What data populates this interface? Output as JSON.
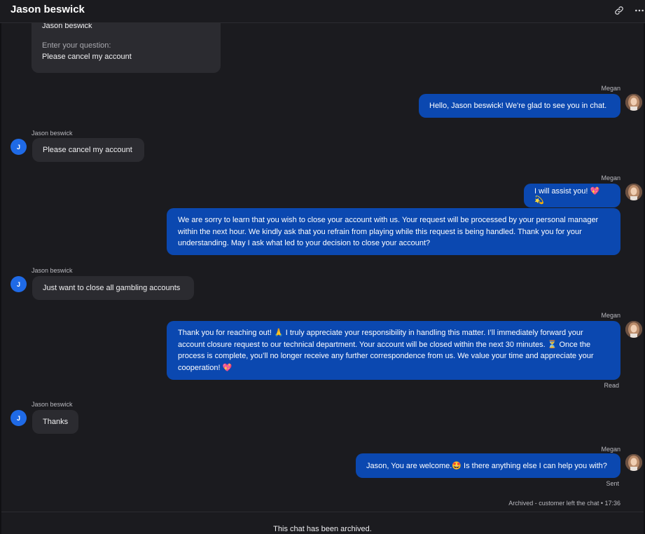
{
  "header": {
    "title": "Jason beswick",
    "link_icon": "link-icon",
    "more_icon": "more-horizontal-icon"
  },
  "form_card": {
    "name_value": "Jason beswick",
    "question_label": "Enter your question:",
    "question_value": "Please cancel my account"
  },
  "agent": {
    "name": "Megan"
  },
  "customer": {
    "name": "Jason beswick",
    "initial": "J"
  },
  "messages": [
    {
      "from": "agent",
      "text": "Hello, Jason beswick! We're glad to see you in chat."
    },
    {
      "from": "customer",
      "text": "Please cancel my account"
    },
    {
      "from": "agent",
      "text": "I will assist you! 💖 💫"
    },
    {
      "from": "agent",
      "text": "We are sorry to learn that you wish to close your account with us. Your request will be processed by your personal manager within the next hour. We kindly ask that you refrain from playing while this request is being handled. Thank you for your understanding. May I ask what led to your decision to close your account?"
    },
    {
      "from": "customer",
      "text": "Just want to close all gambling accounts"
    },
    {
      "from": "agent",
      "text": "Thank you for reaching out! 🙏 I truly appreciate your responsibility in handling this matter. I’ll immediately forward your account closure request to our technical department. Your account will be closed within the next 30 minutes. ⏳ Once the process is complete, you’ll no longer receive any further correspondence from us. We value your time and appreciate your cooperation! 💖"
    },
    {
      "from": "customer",
      "text": "Thanks"
    },
    {
      "from": "agent",
      "text": "Jason, You are welcome.🤩 Is there anything else I can help you with?"
    }
  ],
  "status_read": "Read",
  "status_sent": "Sent",
  "archived_note": "Archived - customer left the chat • 17:36",
  "footer_text": "This chat has been archived.",
  "colors": {
    "background": "#1b1b1f",
    "agent_bubble": "#0b48b0",
    "customer_bubble": "#2b2b30",
    "customer_avatar": "#1f6ae6"
  }
}
